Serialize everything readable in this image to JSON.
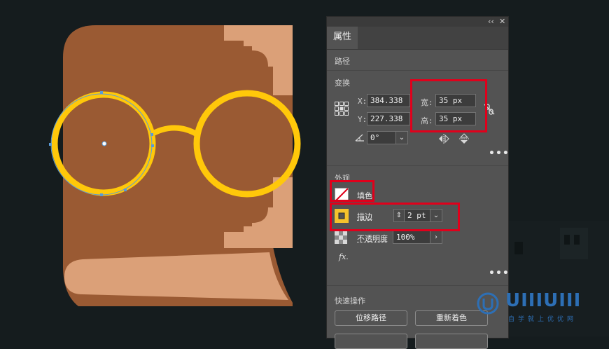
{
  "panel": {
    "collapse_icon": "‹‹",
    "close_icon": "✕",
    "tab": "属性",
    "object_type": "路径",
    "transform": {
      "title": "变换",
      "x_label": "X:",
      "x_value": "384.338",
      "y_label": "Y:",
      "y_value": "227.338",
      "w_label": "宽:",
      "w_value": "35 px",
      "h_label": "高:",
      "h_value": "35 px",
      "angle_value": "0°"
    },
    "appearance": {
      "title": "外观",
      "fill_label": "填色",
      "stroke_label": "描边",
      "stroke_value": "2 pt",
      "opacity_label": "不透明度",
      "opacity_value": "100%",
      "fx_label": "fx."
    },
    "quick_actions": {
      "title": "快速操作",
      "offset_path": "位移路径",
      "recolor": "重新着色"
    },
    "more_label": "•••"
  },
  "colors": {
    "canvas_bg": "#151c1e",
    "book_cover": "#9a5a33",
    "book_pages": "#dba078",
    "glasses": "#ffc80a",
    "highlight_box": "#e0001b",
    "stroke_swatch": "#f5c32c"
  },
  "watermark": {
    "logo_text": "UIIIUIII",
    "slogan": "自学就上优优网"
  }
}
